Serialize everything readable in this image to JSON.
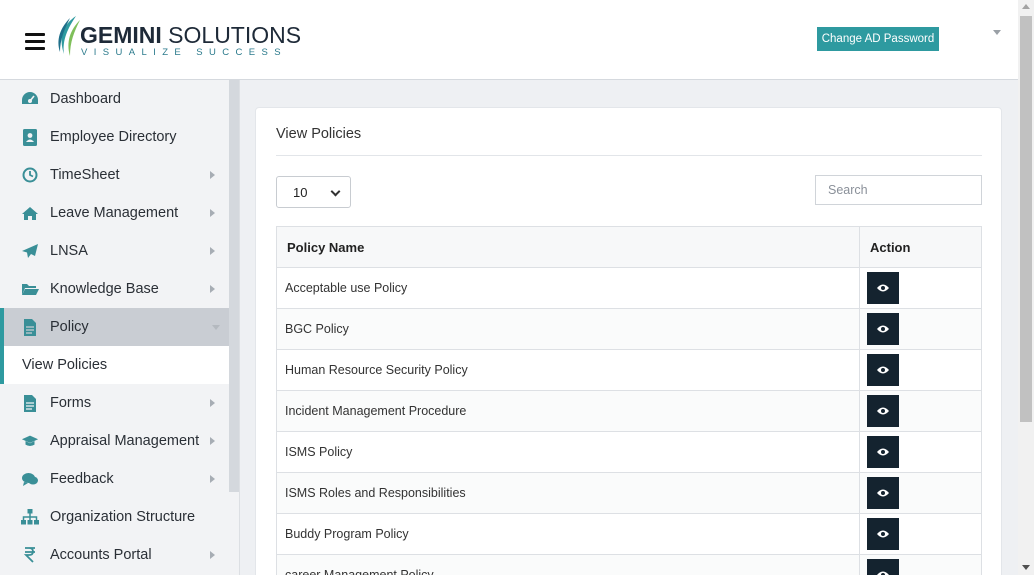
{
  "header": {
    "logo_title_bold": "GEMINI",
    "logo_title_rest": " SOLUTIONS",
    "logo_tagline": "VISUALIZE SUCCESS",
    "change_password_label": "Change AD Password"
  },
  "sidebar": {
    "items": [
      {
        "label": "Dashboard",
        "icon": "dashboard-icon"
      },
      {
        "label": "Employee Directory",
        "icon": "address-book-icon"
      },
      {
        "label": "TimeSheet",
        "icon": "clock-icon"
      },
      {
        "label": "Leave Management",
        "icon": "home-icon"
      },
      {
        "label": "LNSA",
        "icon": "paper-plane-icon"
      },
      {
        "label": "Knowledge Base",
        "icon": "folder-open-icon"
      },
      {
        "label": "Policy",
        "icon": "file-icon"
      },
      {
        "label": "Forms",
        "icon": "file-text-icon"
      },
      {
        "label": "Appraisal Management",
        "icon": "graduation-cap-icon"
      },
      {
        "label": "Feedback",
        "icon": "comments-icon"
      },
      {
        "label": "Organization Structure",
        "icon": "sitemap-icon"
      },
      {
        "label": "Accounts Portal",
        "icon": "rupee-icon"
      }
    ],
    "sub_item": "View Policies"
  },
  "main": {
    "title": "View Policies",
    "page_length": "10",
    "search_placeholder": "Search",
    "columns": [
      "Policy Name",
      "Action"
    ],
    "rows": [
      "Acceptable use Policy",
      "BGC Policy",
      "Human Resource Security Policy",
      "Incident Management Procedure",
      "ISMS Policy",
      "ISMS Roles and Responsibilities",
      "Buddy Program Policy",
      "career Management Policy"
    ]
  },
  "colors": {
    "accent": "#2e9aa0",
    "action_button": "#14232f"
  }
}
